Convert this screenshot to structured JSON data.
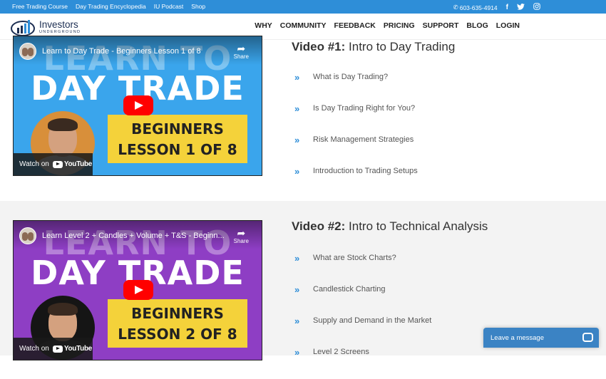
{
  "topbar": {
    "links": [
      "Free Trading Course",
      "Day Trading Encyclopedia",
      "IU Podcast",
      "Shop"
    ],
    "phone": "603-635-4914",
    "social": [
      "f",
      "t",
      "ig"
    ]
  },
  "header": {
    "logo": {
      "line1": "Investors",
      "line2": "UNDERGROUND"
    },
    "nav": [
      "WHY",
      "COMMUNITY",
      "FEEDBACK",
      "PRICING",
      "SUPPORT",
      "BLOG",
      "LOGIN"
    ]
  },
  "videos": [
    {
      "title": "Learn to Day Trade - Beginners Lesson 1 of 8",
      "share_label": "Share",
      "big_text": "DAY TRADE",
      "faded_text": "LEARN TO",
      "lesson_line1": "BEGINNERS",
      "lesson_line2": "LESSON 1 OF 8",
      "watch_label": "Watch on",
      "yt_label": "YouTube",
      "heading_num": "Video #1:",
      "heading_title": "Intro to Day Trading",
      "topics": [
        "What is Day Trading?",
        "Is Day Trading Right for You?",
        "Risk Management Strategies",
        "Introduction to Trading Setups"
      ]
    },
    {
      "title": "Learn Level 2 + Candles + Volume + T&S - Beginn...",
      "share_label": "Share",
      "big_text": "DAY TRADE",
      "faded_text": "LEARN TO",
      "lesson_line1": "BEGINNERS",
      "lesson_line2": "LESSON 2 OF 8",
      "watch_label": "Watch on",
      "yt_label": "YouTube",
      "heading_num": "Video #2:",
      "heading_title": "Intro to Technical Analysis",
      "topics": [
        "What are Stock Charts?",
        "Candlestick Charting",
        "Supply and Demand in the Market",
        "Level 2 Screens"
      ]
    }
  ],
  "chat": {
    "label": "Leave a message"
  },
  "colors": {
    "topbar": "#2e8ed8",
    "chevron": "#2e8ed8",
    "lesson_box": "#f4d23a",
    "video1_bg": "#3aa5ec",
    "video2_bg": "#8e3ec4"
  }
}
